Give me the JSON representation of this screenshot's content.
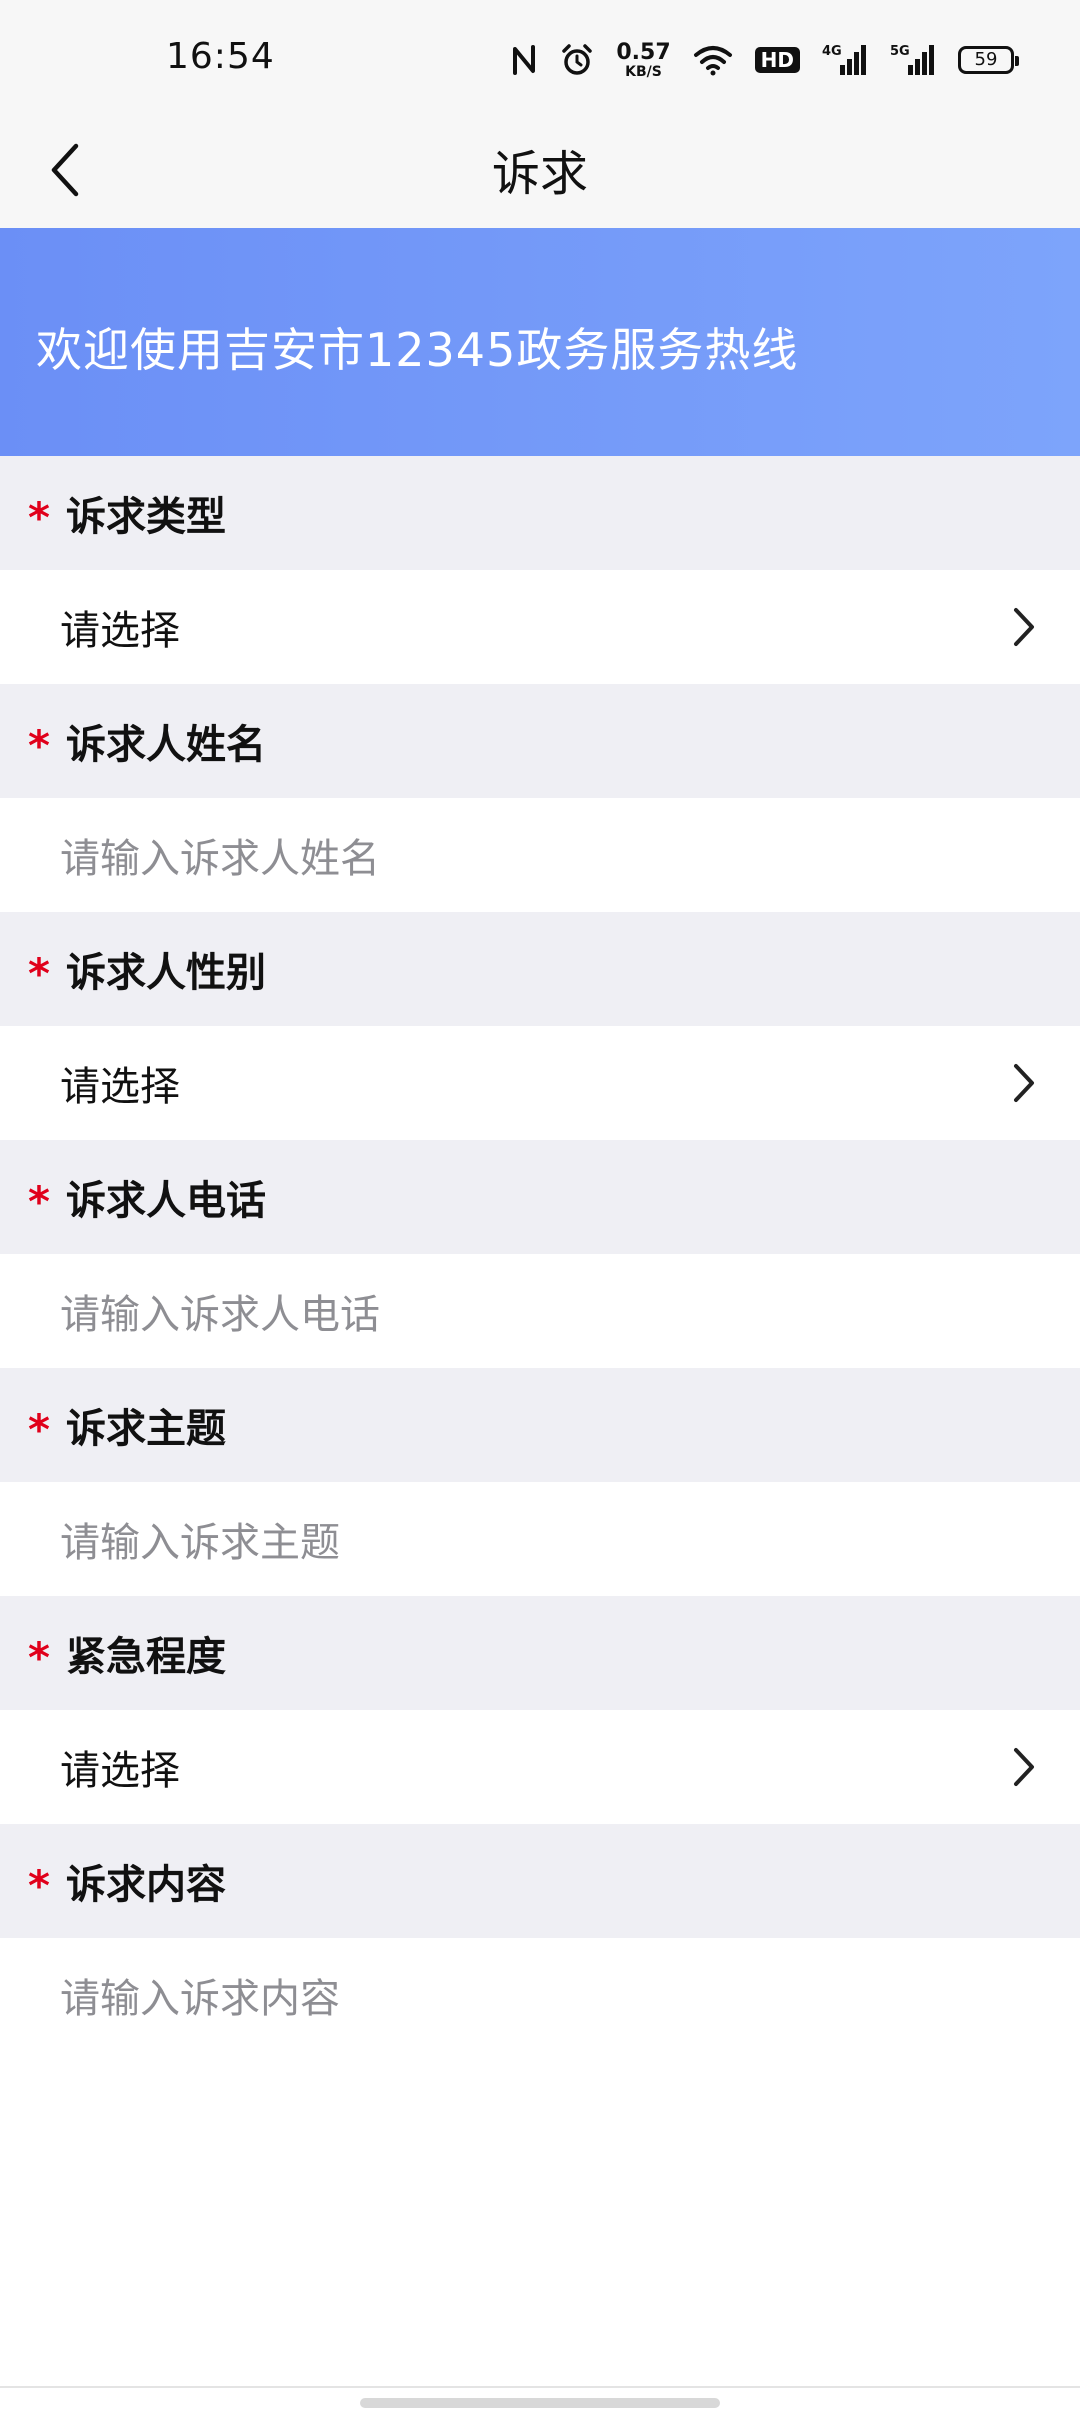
{
  "status_bar": {
    "time": "16:54",
    "net_speed_value": "0.57",
    "net_speed_unit": "KB/S",
    "hd_label": "HD",
    "net_4g": "4G",
    "net_5g": "5G",
    "battery": "59",
    "icons": [
      "nfc-icon",
      "alarm-icon",
      "wifi-icon",
      "signal-4g-icon",
      "signal-5g-icon",
      "battery-icon"
    ]
  },
  "header": {
    "title": "诉求",
    "back_icon": "chevron-left-icon"
  },
  "banner": {
    "text": "欢迎使用吉安市12345政务服务热线",
    "colors": {
      "start": "#6b8ff6",
      "end": "#7da4fb"
    }
  },
  "form": {
    "required_mark": "*",
    "fields": [
      {
        "label": "诉求类型",
        "type": "select",
        "value": "请选择"
      },
      {
        "label": "诉求人姓名",
        "type": "input",
        "placeholder": "请输入诉求人姓名"
      },
      {
        "label": "诉求人性别",
        "type": "select",
        "value": "请选择"
      },
      {
        "label": "诉求人电话",
        "type": "input",
        "placeholder": "请输入诉求人电话"
      },
      {
        "label": "诉求主题",
        "type": "input",
        "placeholder": "请输入诉求主题"
      },
      {
        "label": "紧急程度",
        "type": "select",
        "value": "请选择"
      },
      {
        "label": "诉求内容",
        "type": "input",
        "placeholder": "请输入诉求内容"
      }
    ]
  },
  "colors": {
    "required": "#e0001b",
    "section_bg": "#efeff4",
    "placeholder": "#8e8e93"
  }
}
